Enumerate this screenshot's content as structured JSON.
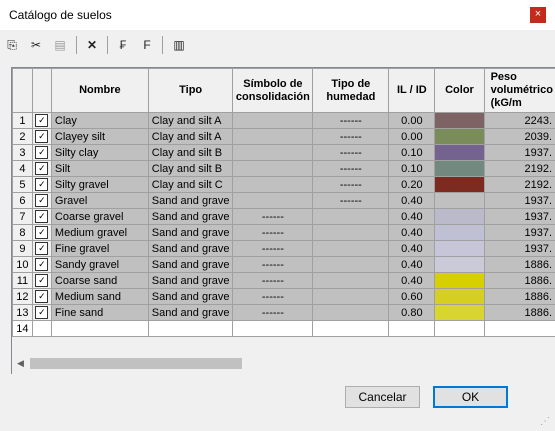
{
  "window": {
    "title": "Catálogo de suelos",
    "close_label": "×"
  },
  "toolbar": {
    "icons": [
      "copy-icon",
      "cut-icon",
      "paste-icon",
      "delete-icon",
      "edit-row-icon",
      "edit-col-icon",
      "table-icon"
    ]
  },
  "table": {
    "headers": [
      "Nombre",
      "Tipo",
      "Símbolo de consolidación",
      "Tipo de humedad",
      "IL / ID",
      "Color",
      "Peso volumétrico (kG/m"
    ],
    "rows": [
      {
        "n": "1",
        "name": "Clay",
        "type": "Clay and silt A",
        "sym": "",
        "hum": "------",
        "il": "0.00",
        "color": "#7d6363",
        "weight": "2243."
      },
      {
        "n": "2",
        "name": "Clayey silt",
        "type": "Clay and silt A",
        "sym": "",
        "hum": "------",
        "il": "0.00",
        "color": "#7a8c5a",
        "weight": "2039."
      },
      {
        "n": "3",
        "name": "Silty clay",
        "type": "Clay and silt B",
        "sym": "",
        "hum": "------",
        "il": "0.10",
        "color": "#74638f",
        "weight": "1937."
      },
      {
        "n": "4",
        "name": "Silt",
        "type": "Clay and silt B",
        "sym": "",
        "hum": "------",
        "il": "0.10",
        "color": "#72897f",
        "weight": "2192."
      },
      {
        "n": "5",
        "name": "Silty gravel",
        "type": "Clay and silt C",
        "sym": "",
        "hum": "------",
        "il": "0.20",
        "color": "#7d2a20",
        "weight": "2192."
      },
      {
        "n": "6",
        "name": "Gravel",
        "type": "Sand and grave",
        "sym": "",
        "hum": "------",
        "il": "0.40",
        "color": "#c0c0c0",
        "weight": "1937."
      },
      {
        "n": "7",
        "name": "Coarse gravel",
        "type": "Sand and grave",
        "sym": "------",
        "hum": "",
        "il": "0.40",
        "color": "#babacb",
        "weight": "1937."
      },
      {
        "n": "8",
        "name": "Medium  gravel",
        "type": "Sand and grave",
        "sym": "------",
        "hum": "",
        "il": "0.40",
        "color": "#c0c0d4",
        "weight": "1937."
      },
      {
        "n": "9",
        "name": "Fine gravel",
        "type": "Sand and grave",
        "sym": "------",
        "hum": "",
        "il": "0.40",
        "color": "#c6c6d8",
        "weight": "1937."
      },
      {
        "n": "10",
        "name": "Sandy  gravel",
        "type": "Sand and grave",
        "sym": "------",
        "hum": "",
        "il": "0.40",
        "color": "#cacad8",
        "weight": "1886."
      },
      {
        "n": "11",
        "name": "Coarse sand",
        "type": "Sand and grave",
        "sym": "------",
        "hum": "",
        "il": "0.40",
        "color": "#d7d000",
        "weight": "1886."
      },
      {
        "n": "12",
        "name": "Medium sand",
        "type": "Sand and grave",
        "sym": "------",
        "hum": "",
        "il": "0.60",
        "color": "#d4cf20",
        "weight": "1886."
      },
      {
        "n": "13",
        "name": "Fine sand",
        "type": "Sand and grave",
        "sym": "------",
        "hum": "",
        "il": "0.80",
        "color": "#d8d430",
        "weight": "1886."
      }
    ],
    "empty_row": "14"
  },
  "buttons": {
    "cancel": "Cancelar",
    "ok": "OK"
  }
}
